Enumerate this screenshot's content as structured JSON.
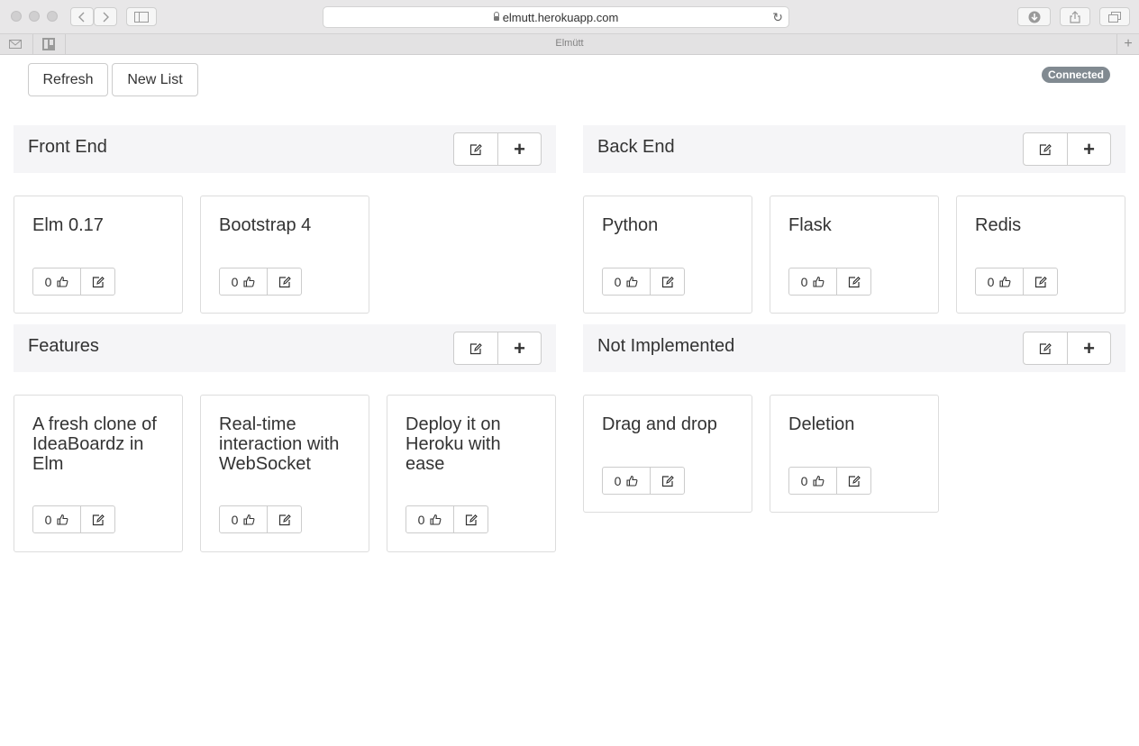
{
  "browser": {
    "url": "elmutt.herokuapp.com",
    "tab_title": "Elmütt"
  },
  "toolbar": {
    "refresh_label": "Refresh",
    "new_list_label": "New List",
    "status": "Connected"
  },
  "lists": [
    {
      "title": "Front End",
      "cards": [
        {
          "title": "Elm 0.17",
          "votes": "0"
        },
        {
          "title": "Bootstrap 4",
          "votes": "0"
        }
      ]
    },
    {
      "title": "Back End",
      "cards": [
        {
          "title": "Python",
          "votes": "0"
        },
        {
          "title": "Flask",
          "votes": "0"
        },
        {
          "title": "Redis",
          "votes": "0"
        }
      ]
    },
    {
      "title": "Features",
      "cards": [
        {
          "title": "A fresh clone of IdeaBoardz in Elm",
          "votes": "0"
        },
        {
          "title": "Real-time interaction with WebSocket",
          "votes": "0"
        },
        {
          "title": "Deploy it on Heroku with ease",
          "votes": "0"
        }
      ]
    },
    {
      "title": "Not Implemented",
      "cards": [
        {
          "title": "Drag and drop",
          "votes": "0"
        },
        {
          "title": "Deletion",
          "votes": "0"
        }
      ]
    }
  ],
  "icons": {
    "edit": "edit-icon",
    "add": "plus-icon",
    "vote": "thumbs-up-icon"
  },
  "colors": {
    "badge": "#818a91",
    "header_bg": "#f5f5f7",
    "border": "#cccccc"
  }
}
